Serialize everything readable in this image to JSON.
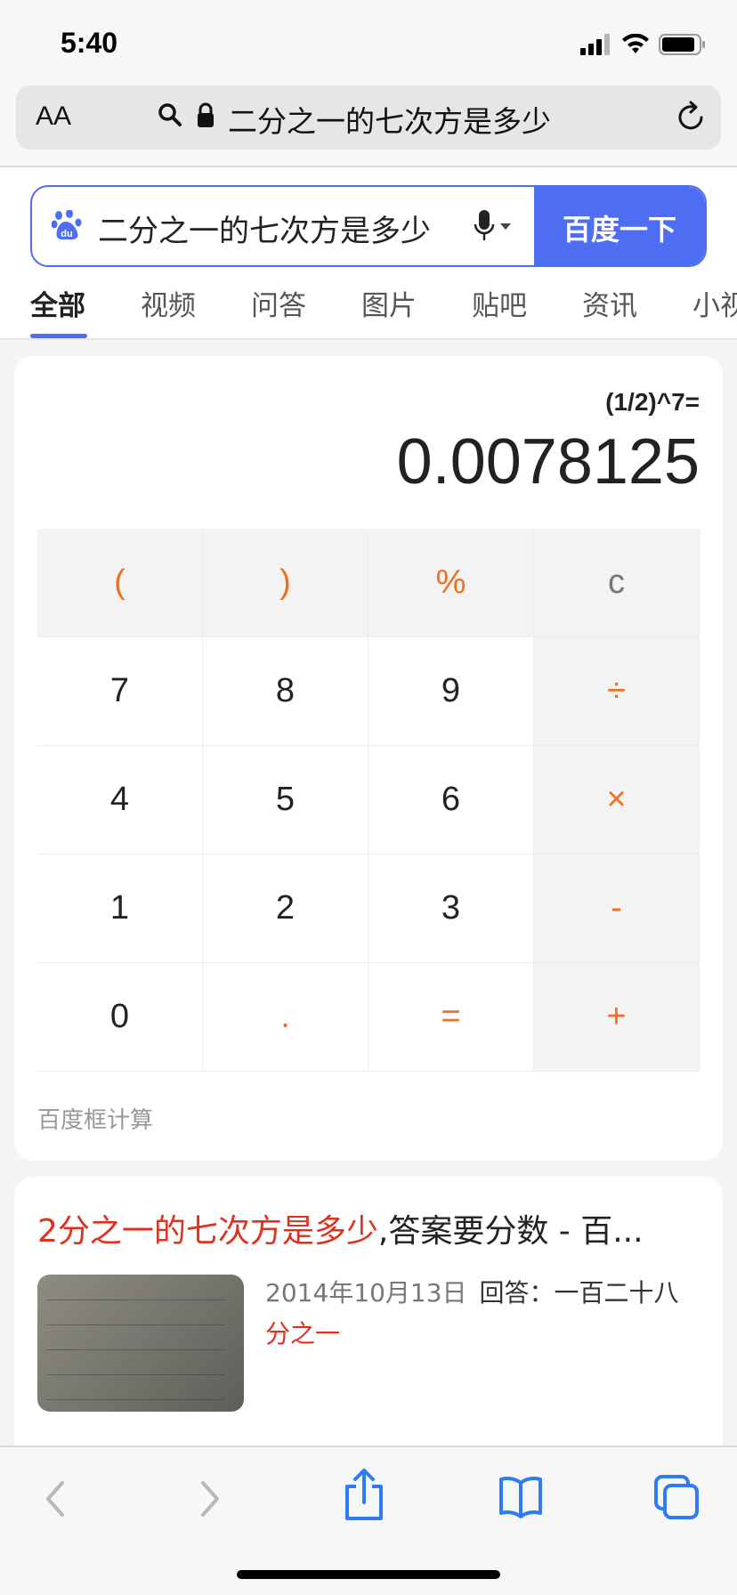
{
  "status_bar": {
    "time": "5:40"
  },
  "browser": {
    "text_size_button": "AA",
    "url_text": "二分之一的七次方是多少"
  },
  "search": {
    "query": "二分之一的七次方是多少",
    "button_label": "百度一下",
    "tabs": [
      "全部",
      "视频",
      "问答",
      "图片",
      "贴吧",
      "资讯",
      "小视"
    ],
    "active_tab": "全部"
  },
  "calculator": {
    "expression": "(1/2)^7=",
    "result": "0.0078125",
    "keys": [
      {
        "label": "(",
        "style": "gray-orange"
      },
      {
        "label": ")",
        "style": "gray-orange"
      },
      {
        "label": "%",
        "style": "gray-orange"
      },
      {
        "label": "c",
        "style": "gray-clear"
      },
      {
        "label": "7",
        "style": "digit"
      },
      {
        "label": "8",
        "style": "digit"
      },
      {
        "label": "9",
        "style": "digit"
      },
      {
        "label": "÷",
        "style": "gray-orange"
      },
      {
        "label": "4",
        "style": "digit"
      },
      {
        "label": "5",
        "style": "digit"
      },
      {
        "label": "6",
        "style": "digit"
      },
      {
        "label": "×",
        "style": "gray-orange"
      },
      {
        "label": "1",
        "style": "digit"
      },
      {
        "label": "2",
        "style": "digit"
      },
      {
        "label": "3",
        "style": "digit"
      },
      {
        "label": "-",
        "style": "gray-orange"
      },
      {
        "label": "0",
        "style": "digit"
      },
      {
        "label": ".",
        "style": "orange"
      },
      {
        "label": "=",
        "style": "orange"
      },
      {
        "label": "+",
        "style": "gray-orange"
      }
    ],
    "footer": "百度框计算"
  },
  "result": {
    "title_highlight": "2分之一的七次方是多少",
    "title_rest": ",答案要分数 - 百...",
    "date": "2014年10月13日",
    "answer_prefix": "回答：一百二十八",
    "answer_highlight": "分之一"
  },
  "colors": {
    "accent": "#4e6ef2",
    "operator": "#f07020",
    "highlight": "#e0301e"
  }
}
